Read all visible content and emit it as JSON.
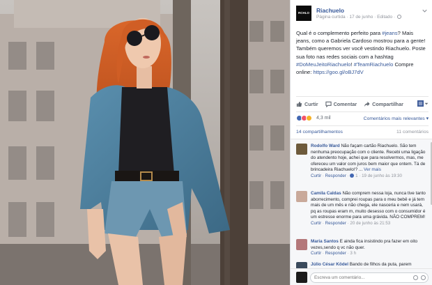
{
  "photo": {
    "alt": ""
  },
  "post": {
    "logo_text": "RCHLO\nRIACHUELO",
    "page_name": "Riachuelo",
    "meta": "Página curtida · 17 de junho · Editado ·",
    "text_parts": {
      "p1": "Qual é o complemento perfeito para ",
      "h1": "#jeans",
      "p2": "? Mais jeans, como a Gabriela Cardoso mostrou para a gente! Também queremos ver você vestindo Riachuelo. Poste sua foto nas redes sociais com a hashtag ",
      "h2": "#DoMeuJeitoRiachuelo",
      "p3": "! ",
      "h3": "#TeamRiachuelo",
      "p4": " Compre online: ",
      "link": "https://goo.gl/oBJ7dV"
    }
  },
  "actions": {
    "like": "Curtir",
    "comment": "Comentar",
    "share": "Compartilhar"
  },
  "reactions": {
    "count": "4,3 mil",
    "sort": "Comentários mais relevantes ▾"
  },
  "stats": {
    "shares": "14 compartilhamentos",
    "comments": "11 comentários"
  },
  "comments": [
    {
      "author": "Rodolfo Ward",
      "text": "Não façam cartão Riachuelo. São tem nenhuma preocupação com o cliente. Recebi uma ligação do atendento hoje, achei que para resolvermos, mas, me ofereceu um valor com juros bem maior que ontem. Tá de brincadeira Riachuelo!? ...",
      "see_more": "Ver mais",
      "like": "Curtir",
      "reply": "Responder",
      "likes": "1",
      "time": "19 de junho às 19:30"
    },
    {
      "author": "Camila Caldas",
      "text": "Não comprem nessa loja, nunca tive tanto aborrecimento, comprei roupas para o meu bebê e já tem mais de um mês e não chega, ele nasceria e nem usará, pq as roupas eram m, muito desesso com o consumidor é um estresse enorme para uma grávida. NÃO COMPREM!",
      "like": "Curtir",
      "reply": "Responder",
      "time": "20 de junho às 21:53"
    },
    {
      "author": "Maria Santos",
      "text": "E ainda fica insistindo pra fazer em oito vezes,sendo q vc não quer.",
      "like": "Curtir",
      "reply": "Responder",
      "time": "3 h"
    },
    {
      "author": "Júlio César Ködel",
      "text": "Bando de filhos da puta, parem"
    }
  ],
  "reply_box": {
    "placeholder": "Escreva um comentário..."
  },
  "colors": {
    "link": "#365899",
    "muted": "#90949c",
    "like_blue": "#4267b2"
  }
}
